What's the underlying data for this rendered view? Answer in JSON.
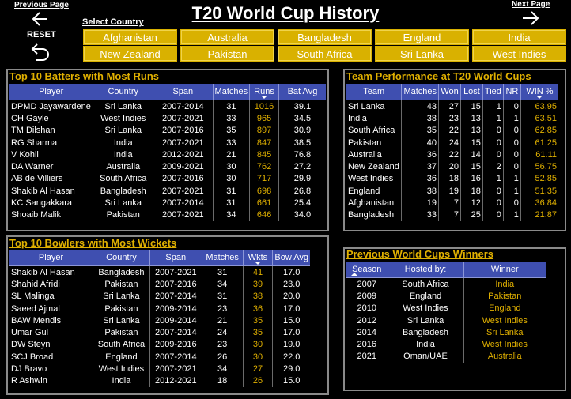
{
  "nav": {
    "previous_page": "Previous Page",
    "next_page": "Next Page",
    "reset": "RESET"
  },
  "title": "T20 World Cup History",
  "select_country_label": "Select Country",
  "countries": [
    "Afghanistan",
    "Australia",
    "Bangladesh",
    "England",
    "India",
    "New Zealand",
    "Pakistan",
    "South Africa",
    "Sri Lanka",
    "West Indies"
  ],
  "batters": {
    "title": "Top 10 Batters with Most Runs",
    "columns": [
      "Player",
      "Country",
      "Span",
      "Matches",
      "Runs",
      "Bat Avg"
    ],
    "rows": [
      [
        "DPMD Jayawardene",
        "Sri Lanka",
        "2007-2014",
        "31",
        "1016",
        "39.1"
      ],
      [
        "CH Gayle",
        "West Indies",
        "2007-2021",
        "33",
        "965",
        "34.5"
      ],
      [
        "TM Dilshan",
        "Sri Lanka",
        "2007-2016",
        "35",
        "897",
        "30.9"
      ],
      [
        "RG Sharma",
        "India",
        "2007-2021",
        "33",
        "847",
        "38.5"
      ],
      [
        "V Kohli",
        "India",
        "2012-2021",
        "21",
        "845",
        "76.8"
      ],
      [
        "DA Warner",
        "Australia",
        "2009-2021",
        "30",
        "762",
        "27.2"
      ],
      [
        "AB de Villiers",
        "South Africa",
        "2007-2016",
        "30",
        "717",
        "29.9"
      ],
      [
        "Shakib Al Hasan",
        "Bangladesh",
        "2007-2021",
        "31",
        "698",
        "26.8"
      ],
      [
        "KC Sangakkara",
        "Sri Lanka",
        "2007-2014",
        "31",
        "661",
        "25.4"
      ],
      [
        "Shoaib Malik",
        "Pakistan",
        "2007-2021",
        "34",
        "646",
        "34.0"
      ]
    ]
  },
  "bowlers": {
    "title": "Top 10 Bowlers with Most Wickets",
    "columns": [
      "Player",
      "Country",
      "Span",
      "Matches",
      "Wkts",
      "Bow Avg"
    ],
    "rows": [
      [
        "Shakib Al Hasan",
        "Bangladesh",
        "2007-2021",
        "31",
        "41",
        "17.0"
      ],
      [
        "Shahid Afridi",
        "Pakistan",
        "2007-2016",
        "34",
        "39",
        "23.0"
      ],
      [
        "SL Malinga",
        "Sri Lanka",
        "2007-2014",
        "31",
        "38",
        "20.0"
      ],
      [
        "Saeed Ajmal",
        "Pakistan",
        "2009-2014",
        "23",
        "36",
        "17.0"
      ],
      [
        "BAW Mendis",
        "Sri Lanka",
        "2009-2014",
        "21",
        "35",
        "15.0"
      ],
      [
        "Umar Gul",
        "Pakistan",
        "2007-2014",
        "24",
        "35",
        "17.0"
      ],
      [
        "DW Steyn",
        "South Africa",
        "2009-2016",
        "23",
        "30",
        "19.0"
      ],
      [
        "SCJ Broad",
        "England",
        "2007-2014",
        "26",
        "30",
        "22.0"
      ],
      [
        "DJ Bravo",
        "West Indies",
        "2007-2021",
        "34",
        "27",
        "29.0"
      ],
      [
        "R Ashwin",
        "India",
        "2012-2021",
        "18",
        "26",
        "15.0"
      ]
    ]
  },
  "teams": {
    "title": "Team Performance at T20 World Cups",
    "columns": [
      "Team",
      "Matches",
      "Won",
      "Lost",
      "Tied",
      "NR",
      "WIN %"
    ],
    "rows": [
      [
        "Sri Lanka",
        "43",
        "27",
        "15",
        "1",
        "0",
        "63.95"
      ],
      [
        "India",
        "38",
        "23",
        "13",
        "1",
        "1",
        "63.51"
      ],
      [
        "South Africa",
        "35",
        "22",
        "13",
        "0",
        "0",
        "62.85"
      ],
      [
        "Pakistan",
        "40",
        "24",
        "15",
        "0",
        "0",
        "61.25"
      ],
      [
        "Australia",
        "36",
        "22",
        "14",
        "0",
        "0",
        "61.11"
      ],
      [
        "New Zealand",
        "37",
        "20",
        "15",
        "2",
        "0",
        "56.75"
      ],
      [
        "West Indies",
        "36",
        "18",
        "16",
        "1",
        "1",
        "52.85"
      ],
      [
        "England",
        "38",
        "19",
        "18",
        "0",
        "1",
        "51.35"
      ],
      [
        "Afghanistan",
        "19",
        "7",
        "12",
        "0",
        "0",
        "36.84"
      ],
      [
        "Bangladesh",
        "33",
        "7",
        "25",
        "0",
        "1",
        "21.87"
      ]
    ]
  },
  "winners": {
    "title": "Previous World Cups Winners",
    "columns": [
      "Season",
      "Hosted by:",
      "Winner"
    ],
    "rows": [
      [
        "2007",
        "South Africa",
        "India"
      ],
      [
        "2009",
        "England",
        "Pakistan"
      ],
      [
        "2010",
        "West Indies",
        "England"
      ],
      [
        "2012",
        "Sri Lanka",
        "West Indies"
      ],
      [
        "2014",
        "Bangladesh",
        "Sri Lanka"
      ],
      [
        "2016",
        "India",
        "West Indies"
      ],
      [
        "2021",
        "Oman/UAE",
        "Australia"
      ]
    ]
  }
}
